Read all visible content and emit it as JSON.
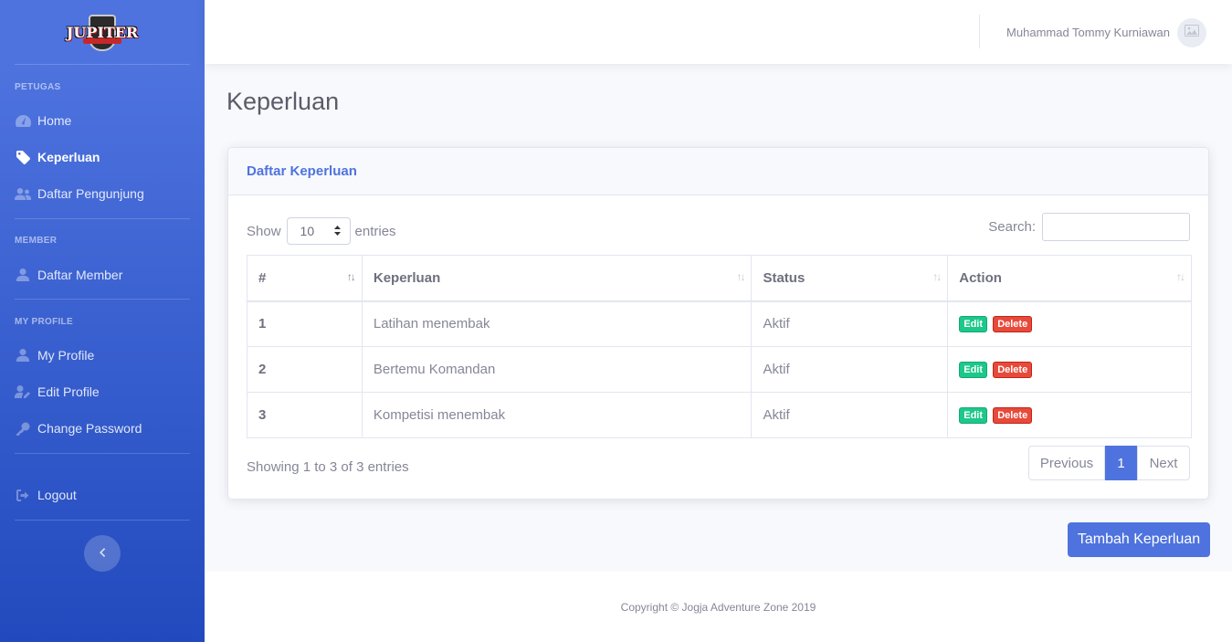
{
  "sidebar": {
    "logo_text": "JUPITER",
    "sections": {
      "petugas": "PETUGAS",
      "member": "MEMBER",
      "my_profile": "MY PROFILE"
    },
    "items": {
      "home": "Home",
      "keperluan": "Keperluan",
      "daftar_pengunjung": "Daftar Pengunjung",
      "daftar_member": "Daftar Member",
      "my_profile": "My Profile",
      "edit_profile": "Edit Profile",
      "change_password": "Change Password",
      "logout": "Logout"
    },
    "active_item": "keperluan"
  },
  "topbar": {
    "user_name": "Muhammad Tommy Kurniawan"
  },
  "page": {
    "title": "Keperluan"
  },
  "card": {
    "title": "Daftar Keperluan",
    "show_label": "Show",
    "entries_label": "entries",
    "page_length": "10",
    "search_label": "Search:",
    "search_value": "",
    "columns": [
      "#",
      "Keperluan",
      "Status",
      "Action"
    ],
    "rows": [
      {
        "no": "1",
        "keperluan": "Latihan menembak",
        "status": "Aktif"
      },
      {
        "no": "2",
        "keperluan": "Bertemu Komandan",
        "status": "Aktif"
      },
      {
        "no": "3",
        "keperluan": "Kompetisi menembak",
        "status": "Aktif"
      }
    ],
    "edit_label": "Edit",
    "delete_label": "Delete",
    "info": "Showing 1 to 3 of 3 entries",
    "pagination": {
      "previous": "Previous",
      "current": "1",
      "next": "Next"
    }
  },
  "add_button": "Tambah Keperluan",
  "footer": {
    "copyright": "Copyright © Jogja Adventure Zone 2019"
  },
  "colors": {
    "primary": "#4e73df",
    "success": "#1cc88a",
    "danger": "#e74a3b"
  }
}
